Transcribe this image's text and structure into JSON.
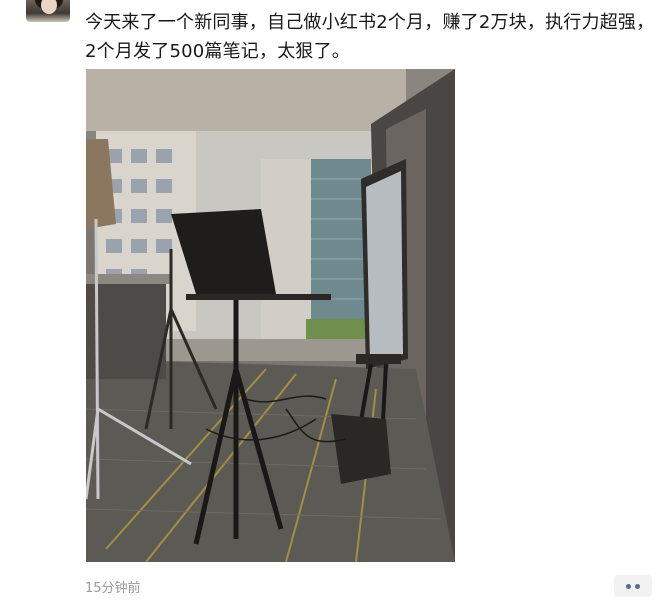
{
  "post": {
    "text": "今天来了一个新同事，自己做小红书2个月，赚了2万块，执行力超强，2个月发了500篇笔记，太狠了。",
    "timestamp": "15分钟前"
  },
  "icons": {
    "avatar": "user-avatar",
    "more": "more-options-icon"
  },
  "colors": {
    "text": "#191919",
    "timestamp": "#9b9b9b",
    "more_dots": "#5b6b8c",
    "more_bg": "#f2f2f2"
  }
}
